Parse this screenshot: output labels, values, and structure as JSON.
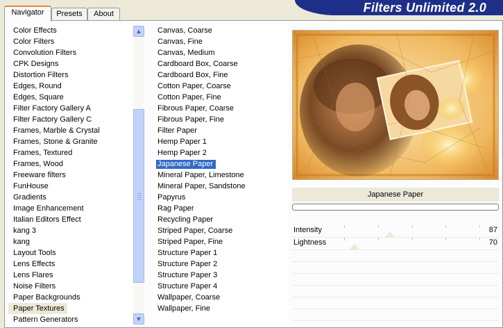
{
  "tabs": [
    {
      "label": "Navigator",
      "active": true
    },
    {
      "label": "Presets",
      "active": false
    },
    {
      "label": "About",
      "active": false
    }
  ],
  "banner": {
    "title": "Filters Unlimited 2.0"
  },
  "categories": {
    "selected": "Paper Textures",
    "items": [
      "Color Effects",
      "Color Filters",
      "Convolution Filters",
      "CPK Designs",
      "Distortion Filters",
      "Edges, Round",
      "Edges, Square",
      "Filter Factory Gallery A",
      "Filter Factory Gallery C",
      "Frames, Marble & Crystal",
      "Frames, Stone & Granite",
      "Frames, Textured",
      "Frames, Wood",
      "Freeware filters",
      "FunHouse",
      "Gradients",
      "Image Enhancement",
      "Italian Editors Effect",
      "kang 3",
      "kang",
      "Layout Tools",
      "Lens Effects",
      "Lens Flares",
      "Noise Filters",
      "Paper Backgrounds",
      "Paper Textures",
      "Pattern Generators"
    ]
  },
  "filters": {
    "selected": "Japanese Paper",
    "items": [
      "Canvas, Coarse",
      "Canvas, Fine",
      "Canvas, Medium",
      "Cardboard Box, Coarse",
      "Cardboard Box, Fine",
      "Cotton Paper, Coarse",
      "Cotton Paper, Fine",
      "Fibrous Paper, Coarse",
      "Fibrous Paper, Fine",
      "Filter Paper",
      "Hemp Paper 1",
      "Hemp Paper 2",
      "Japanese Paper",
      "Mineral Paper, Limestone",
      "Mineral Paper, Sandstone",
      "Papyrus",
      "Rag Paper",
      "Recycling Paper",
      "Striped Paper, Coarse",
      "Striped Paper, Fine",
      "Structure Paper 1",
      "Structure Paper 2",
      "Structure Paper 3",
      "Structure Paper 4",
      "Wallpaper, Coarse",
      "Wallpaper, Fine"
    ]
  },
  "preview": {
    "filter_name": "Japanese Paper",
    "progress": 0
  },
  "sliders": [
    {
      "label": "Intensity",
      "value": "87",
      "fraction": 0.34
    },
    {
      "label": "Lightness",
      "value": "70",
      "fraction": 0.075
    }
  ],
  "colors": {
    "accent": "#316ac5",
    "banner": "#1e2f8a",
    "panel": "#ece9d8"
  },
  "icons": {
    "scroll_up": "chevron-up-icon",
    "scroll_down": "chevron-down-icon"
  }
}
